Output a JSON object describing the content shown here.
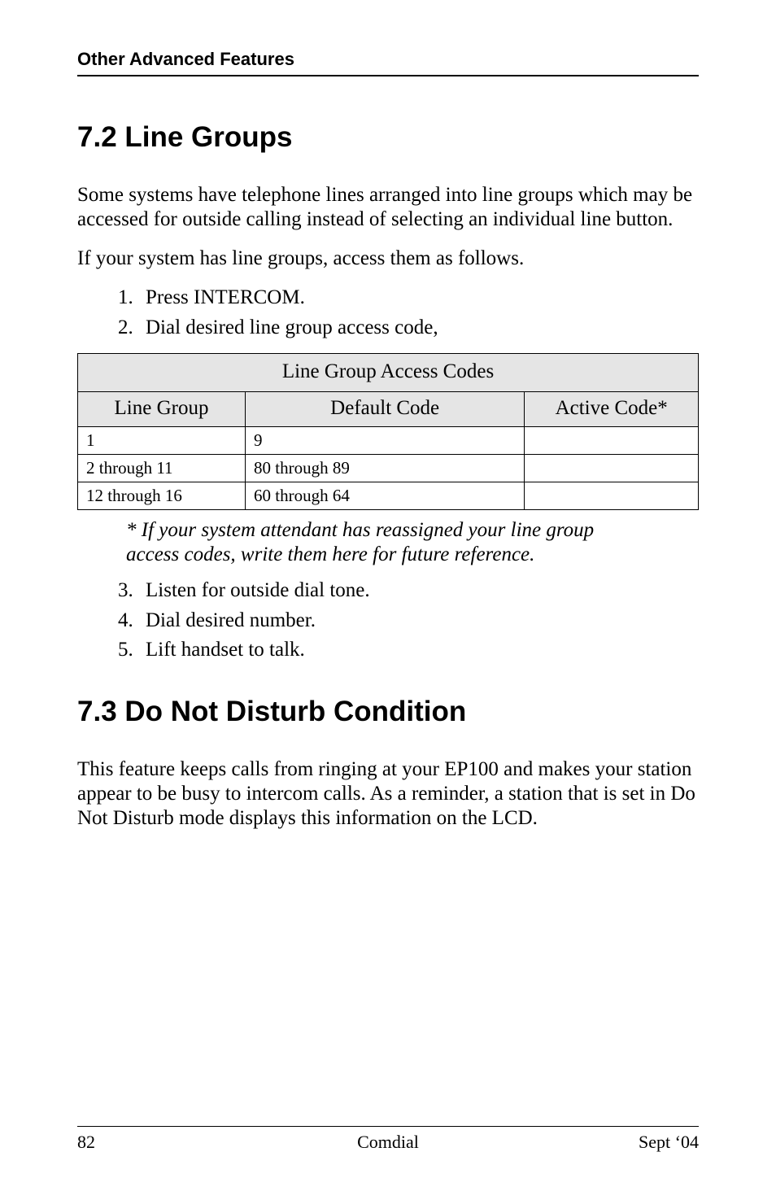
{
  "header": {
    "running_head": "Other Advanced Features"
  },
  "section1": {
    "title": "7.2  Line Groups",
    "para1": "Some systems have telephone lines arranged into line groups which may be accessed for outside calling instead of selecting an individual line button.",
    "para2": "If your system has line groups, access them as follows.",
    "steps_top": [
      "Press INTERCOM.",
      "Dial desired line group access code,"
    ],
    "note": "* If your system attendant has reassigned your line group access codes, write them here for future reference.",
    "steps_bottom": [
      "Listen for outside dial tone.",
      "Dial desired number.",
      "Lift handset to talk."
    ]
  },
  "chart_data": {
    "type": "table",
    "title": "Line Group Access Codes",
    "columns": [
      "Line Group",
      "Default Code",
      "Active Code*"
    ],
    "rows": [
      {
        "line_group": "1",
        "default_code": "9",
        "active_code": ""
      },
      {
        "line_group": "2 through 11",
        "default_code": "80  through  89",
        "active_code": ""
      },
      {
        "line_group": "12 through 16",
        "default_code": "60  through  64",
        "active_code": ""
      }
    ]
  },
  "section2": {
    "title": "7.3  Do Not Disturb Condition",
    "para1": "This feature keeps calls from ringing at your EP100 and makes your station appear to be busy to intercom calls.  As a reminder, a station that is set in Do Not Disturb mode displays this information on the LCD."
  },
  "footer": {
    "page": "82",
    "brand": "Comdial",
    "date": "Sept ‘ 04",
    "date_display": "Sept ‘04"
  }
}
